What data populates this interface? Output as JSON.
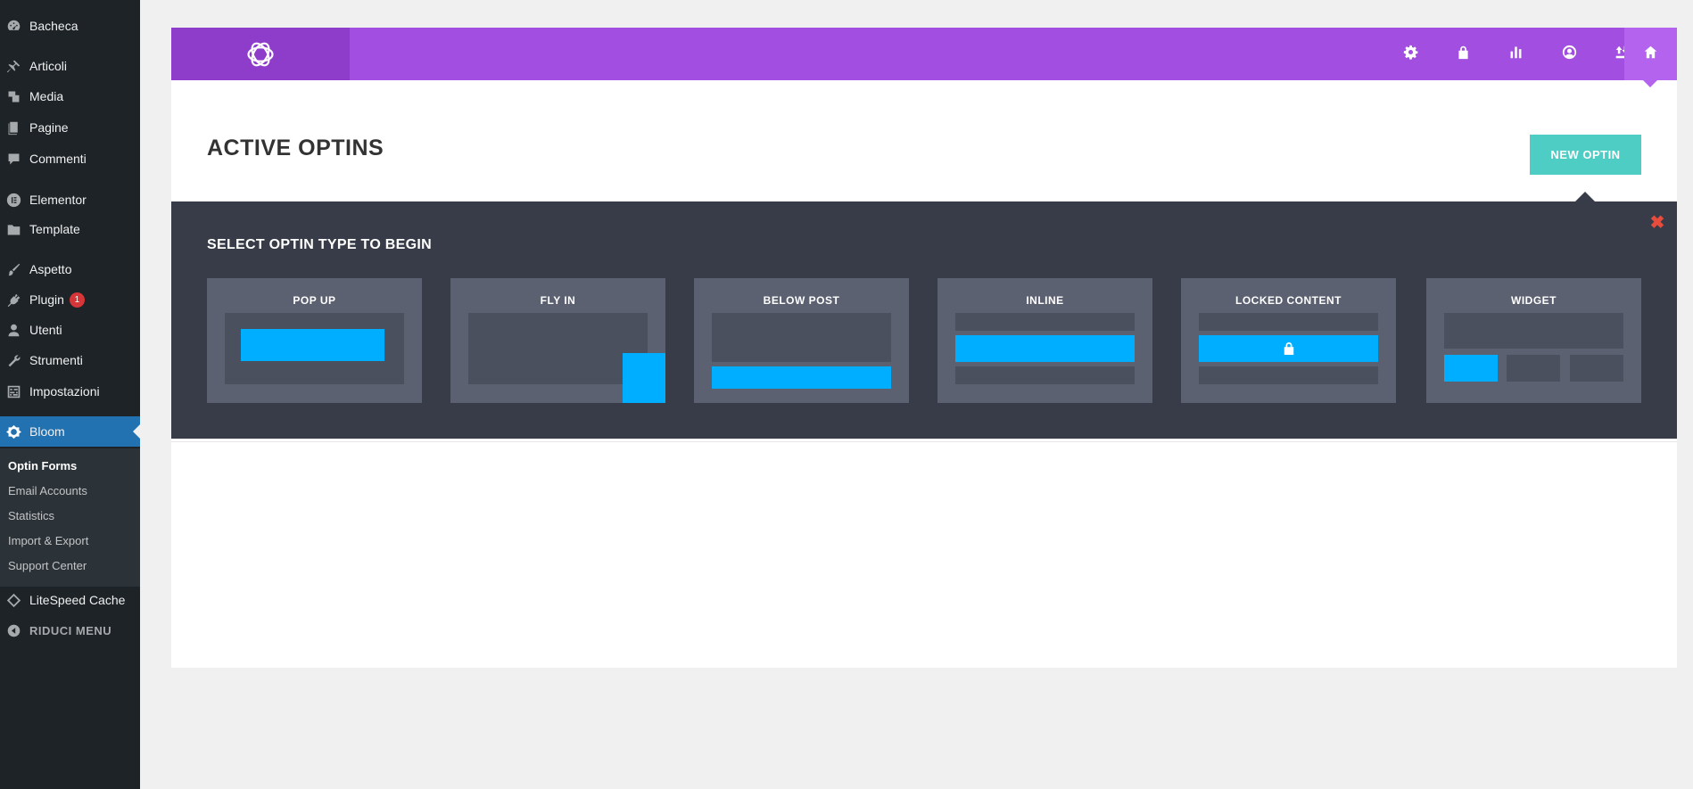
{
  "sidebar": {
    "items": [
      {
        "label": "Bacheca",
        "icon": "dashboard-icon"
      },
      {
        "label": "Articoli",
        "icon": "pin-icon"
      },
      {
        "label": "Media",
        "icon": "media-icon"
      },
      {
        "label": "Pagine",
        "icon": "pages-icon"
      },
      {
        "label": "Commenti",
        "icon": "comment-icon"
      },
      {
        "label": "Elementor",
        "icon": "elementor-icon"
      },
      {
        "label": "Template",
        "icon": "folder-icon"
      },
      {
        "label": "Aspetto",
        "icon": "brush-icon"
      },
      {
        "label": "Plugin",
        "icon": "plugin-icon",
        "badge": "1"
      },
      {
        "label": "Utenti",
        "icon": "user-icon"
      },
      {
        "label": "Strumenti",
        "icon": "wrench-icon"
      },
      {
        "label": "Impostazioni",
        "icon": "settings-icon"
      },
      {
        "label": "Bloom",
        "icon": "bloom-icon",
        "active": true
      }
    ],
    "submenu": [
      {
        "label": "Optin Forms",
        "current": true
      },
      {
        "label": "Email Accounts"
      },
      {
        "label": "Statistics"
      },
      {
        "label": "Import & Export"
      },
      {
        "label": "Support Center"
      }
    ],
    "after": [
      {
        "label": "LiteSpeed Cache",
        "icon": "litespeed-icon"
      },
      {
        "label": "RIDUCI MENU",
        "icon": "collapse-icon"
      }
    ]
  },
  "toolbar": {
    "icons": [
      "gear-icon",
      "lock-icon",
      "stats-icon",
      "account-icon",
      "import-export-icon",
      "home-icon"
    ]
  },
  "header": {
    "title": "ACTIVE OPTINS",
    "new_optin_label": "NEW OPTIN"
  },
  "optin_select": {
    "title": "SELECT OPTIN TYPE TO BEGIN",
    "close_glyph": "✖",
    "types": [
      {
        "label": "POP UP"
      },
      {
        "label": "FLY IN"
      },
      {
        "label": "BELOW POST"
      },
      {
        "label": "INLINE"
      },
      {
        "label": "LOCKED CONTENT"
      },
      {
        "label": "WIDGET"
      }
    ]
  },
  "colors": {
    "sidebar_bg": "#1d2327",
    "active_menu": "#2271b1",
    "topbar": "#a24ee0",
    "new_optin_button": "#4ecdc4",
    "dark_section": "#373c48",
    "card": "#5c6172",
    "accent_blue": "#00aeff",
    "close_red": "#e74c3c"
  }
}
